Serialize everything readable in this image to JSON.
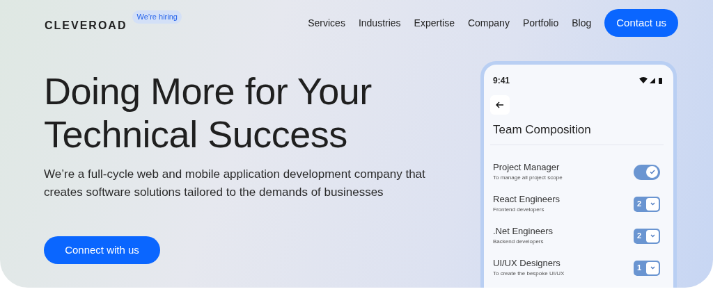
{
  "brand": {
    "logo": "CLEVEROAD",
    "badge": "We’re hiring"
  },
  "nav": {
    "links": [
      "Services",
      "Industries",
      "Expertise",
      "Company",
      "Portfolio",
      "Blog"
    ],
    "cta": "Contact us"
  },
  "hero": {
    "headline": "Doing More for Your Technical Success",
    "description": "We’re a full-cycle web and mobile application development company that creates software solutions tailored to the demands of businesses",
    "button": "Connect with us"
  },
  "phone": {
    "time": "9:41",
    "title": "Team Composition",
    "rows": [
      {
        "kind": "toggle",
        "name": "Project Manager",
        "note": "To manage all project scope",
        "on": true
      },
      {
        "kind": "count",
        "name": "React Engineers",
        "note": "Frontend developers",
        "count": "2"
      },
      {
        "kind": "count",
        "name": ".Net Engineers",
        "note": "Backend developers",
        "count": "2"
      },
      {
        "kind": "count",
        "name": "UI/UX Designers",
        "note": "To create the bespoke UI/UX",
        "count": "1"
      }
    ]
  }
}
